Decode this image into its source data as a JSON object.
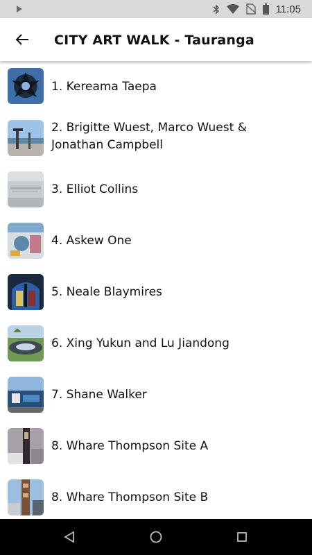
{
  "status": {
    "time": "11:05",
    "icons": [
      "play-icon",
      "bluetooth-icon",
      "wifi-icon",
      "no-sim-icon",
      "battery-icon"
    ]
  },
  "header": {
    "title": "CITY ART WALK - Tauranga",
    "back_icon": "arrow-back-icon"
  },
  "items": [
    {
      "label": "1. Kereama Taepa"
    },
    {
      "label": "2. Brigitte Wuest, Marco Wuest & Jonathan Campbell"
    },
    {
      "label": "3. Elliot Collins"
    },
    {
      "label": "4. Askew One"
    },
    {
      "label": "5. Neale Blaymires"
    },
    {
      "label": "6. Xing Yukun and Lu Jiandong"
    },
    {
      "label": "7. Shane Walker"
    },
    {
      "label": "8. Whare Thompson Site A"
    },
    {
      "label": "8. Whare Thompson Site B"
    }
  ],
  "navbar": {
    "icons": [
      "back-triangle-icon",
      "home-circle-icon",
      "recents-square-icon"
    ]
  }
}
